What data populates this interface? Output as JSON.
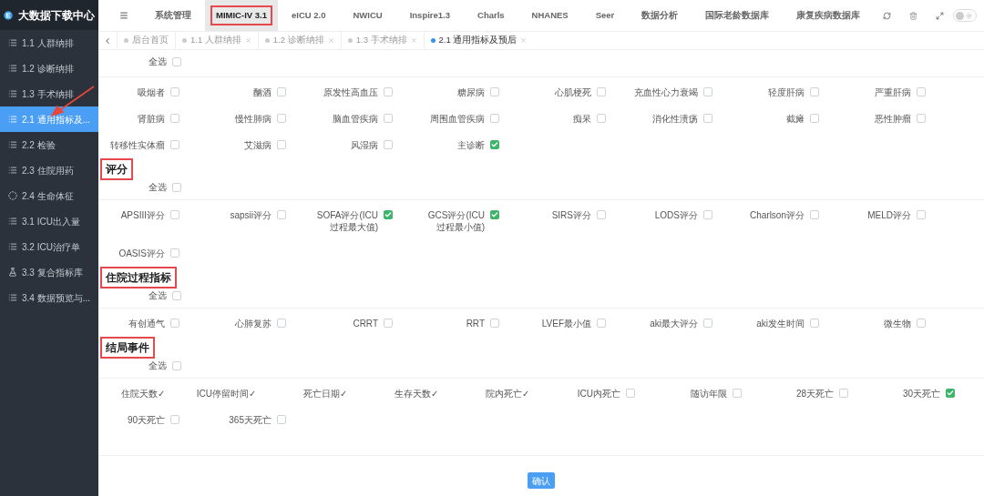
{
  "app": {
    "title": "大数据下载中心"
  },
  "sidebar": {
    "items": [
      {
        "label": "1.1 人群纳排",
        "kind": "list",
        "selected": false
      },
      {
        "label": "1.2 诊断纳排",
        "kind": "list",
        "selected": false
      },
      {
        "label": "1.3 手术纳排",
        "kind": "list",
        "selected": false
      },
      {
        "label": "2.1 通用指标及...",
        "kind": "list",
        "selected": true
      },
      {
        "label": "2.2 检验",
        "kind": "list",
        "selected": false
      },
      {
        "label": "2.3 住院用药",
        "kind": "list",
        "selected": false
      },
      {
        "label": "2.4 生命体征",
        "kind": "vital",
        "selected": false
      },
      {
        "label": "3.1 ICU出入量",
        "kind": "list",
        "selected": false
      },
      {
        "label": "3.2 ICU治疗单",
        "kind": "list",
        "selected": false
      },
      {
        "label": "3.3 复合指标库",
        "kind": "lab",
        "selected": false
      },
      {
        "label": "3.4 数据预览与...",
        "kind": "list",
        "selected": false
      }
    ]
  },
  "top_nav": [
    {
      "label": "系统管理",
      "selected": false,
      "highlighted": false
    },
    {
      "label": "MIMIC-IV 3.1",
      "selected": true,
      "highlighted": true
    },
    {
      "label": "eICU 2.0",
      "selected": false,
      "highlighted": false
    },
    {
      "label": "NWICU",
      "selected": false,
      "highlighted": false
    },
    {
      "label": "Inspire1.3",
      "selected": false,
      "highlighted": false
    },
    {
      "label": "Charls",
      "selected": false,
      "highlighted": false
    },
    {
      "label": "NHANES",
      "selected": false,
      "highlighted": false
    },
    {
      "label": "Seer",
      "selected": false,
      "highlighted": false
    },
    {
      "label": "数据分析",
      "selected": false,
      "highlighted": false
    },
    {
      "label": "国际老龄数据库",
      "selected": false,
      "highlighted": false
    },
    {
      "label": "康复疾病数据库",
      "selected": false,
      "highlighted": false
    }
  ],
  "theme_toggle": {
    "on": false
  },
  "tabs": [
    {
      "label": "后台首页",
      "selected": false,
      "closable": false
    },
    {
      "label": "1.1 人群纳排",
      "selected": false,
      "closable": true
    },
    {
      "label": "1.2 诊断纳排",
      "selected": false,
      "closable": true
    },
    {
      "label": "1.3 手术纳排",
      "selected": false,
      "closable": true
    },
    {
      "label": "2.1 通用指标及预后",
      "selected": true,
      "closable": true
    }
  ],
  "sections": [
    {
      "select_all": {
        "label": "全选",
        "checked": false
      },
      "items": [
        {
          "label": "吸烟者",
          "kind": "checkbox",
          "checked": false
        },
        {
          "label": "酗酒",
          "kind": "checkbox",
          "checked": false
        },
        {
          "label": "原发性高血压",
          "kind": "checkbox",
          "checked": false
        },
        {
          "label": "糖尿病",
          "kind": "checkbox",
          "checked": false
        },
        {
          "label": "心肌梗死",
          "kind": "checkbox",
          "checked": false
        },
        {
          "label": "充血性心力衰竭",
          "kind": "checkbox",
          "checked": false
        },
        {
          "label": "轻度肝病",
          "kind": "checkbox",
          "checked": false
        },
        {
          "label": "严重肝病",
          "kind": "checkbox",
          "checked": false
        },
        {
          "label": "肾脏病",
          "kind": "checkbox",
          "checked": false
        },
        {
          "label": "慢性肺病",
          "kind": "checkbox",
          "checked": false
        },
        {
          "label": "脑血管疾病",
          "kind": "checkbox",
          "checked": false
        },
        {
          "label": "周围血管疾病",
          "kind": "checkbox",
          "checked": false
        },
        {
          "label": "痴呆",
          "kind": "checkbox",
          "checked": false
        },
        {
          "label": "消化性溃疡",
          "kind": "checkbox",
          "checked": false
        },
        {
          "label": "截瘫",
          "kind": "checkbox",
          "checked": false
        },
        {
          "label": "恶性肿瘤",
          "kind": "checkbox",
          "checked": false
        },
        {
          "label": "转移性实体瘤",
          "kind": "checkbox",
          "checked": false
        },
        {
          "label": "艾滋病",
          "kind": "checkbox",
          "checked": false
        },
        {
          "label": "风湿病",
          "kind": "checkbox",
          "checked": false
        },
        {
          "label": "主诊断",
          "kind": "checkbox",
          "checked": true
        }
      ]
    },
    {
      "title": "评分",
      "highlighted": true,
      "select_all": {
        "label": "全选",
        "checked": false
      },
      "items": [
        {
          "label": "APSIII评分",
          "kind": "checkbox",
          "checked": false
        },
        {
          "label": "sapsii评分",
          "kind": "checkbox",
          "checked": false
        },
        {
          "label": "SOFA评分(ICU过程最大值)",
          "kind": "checkbox",
          "checked": true
        },
        {
          "label": "GCS评分(ICU过程最小值)",
          "kind": "checkbox",
          "checked": true
        },
        {
          "label": "SIRS评分",
          "kind": "checkbox",
          "checked": false
        },
        {
          "label": "LODS评分",
          "kind": "checkbox",
          "checked": false
        },
        {
          "label": "Charlson评分",
          "kind": "checkbox",
          "checked": false
        },
        {
          "label": "MELD评分",
          "kind": "checkbox",
          "checked": false
        },
        {
          "label": "OASIS评分",
          "kind": "checkbox",
          "checked": false
        }
      ]
    },
    {
      "title": "住院过程指标",
      "highlighted": true,
      "select_all": {
        "label": "全选",
        "checked": false
      },
      "items": [
        {
          "label": "有创通气",
          "kind": "checkbox",
          "checked": false
        },
        {
          "label": "心肺复苏",
          "kind": "checkbox",
          "checked": false
        },
        {
          "label": "CRRT",
          "kind": "checkbox",
          "checked": false
        },
        {
          "label": "RRT",
          "kind": "checkbox",
          "checked": false
        },
        {
          "label": "LVEF最小值",
          "kind": "checkbox",
          "checked": false
        },
        {
          "label": "aki最大评分",
          "kind": "checkbox",
          "checked": false
        },
        {
          "label": "aki发生时间",
          "kind": "checkbox",
          "checked": false
        },
        {
          "label": "微生物",
          "kind": "checkbox",
          "checked": false
        }
      ]
    },
    {
      "title": "结局事件",
      "highlighted": true,
      "select_all": {
        "label": "全选",
        "checked": false
      },
      "items": [
        {
          "label": "住院天数✓",
          "kind": "fixed"
        },
        {
          "label": "ICU停留时间✓",
          "kind": "fixed"
        },
        {
          "label": "死亡日期✓",
          "kind": "fixed"
        },
        {
          "label": "生存天数✓",
          "kind": "fixed"
        },
        {
          "label": "院内死亡✓",
          "kind": "fixed"
        },
        {
          "label": "ICU内死亡",
          "kind": "checkbox",
          "checked": false
        },
        {
          "label": "随访年限",
          "kind": "checkbox",
          "checked": false
        },
        {
          "label": "28天死亡",
          "kind": "checkbox",
          "checked": false
        },
        {
          "label": "30天死亡",
          "kind": "checkbox",
          "checked": true
        },
        {
          "label": "90天死亡",
          "kind": "checkbox",
          "checked": false
        },
        {
          "label": "365天死亡",
          "kind": "checkbox",
          "checked": false
        }
      ]
    }
  ],
  "confirm_button": "确认"
}
